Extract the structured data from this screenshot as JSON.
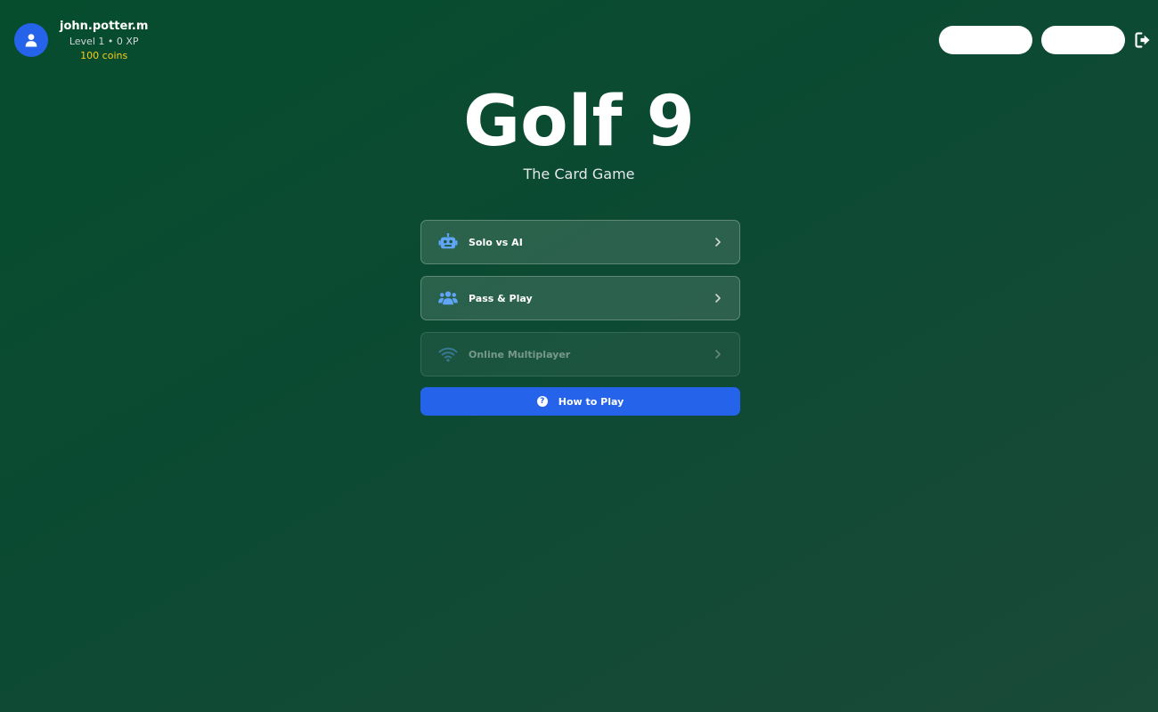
{
  "user": {
    "username": "john.potter.m",
    "level_text": "Level 1 • 0 XP",
    "coins_text": "100 coins",
    "avatar_icon": "user-icon"
  },
  "header": {
    "logout_icon": "logout-icon"
  },
  "hero": {
    "title": "Golf 9",
    "subtitle": "The Card Game"
  },
  "menu": {
    "items": [
      {
        "label": "Solo vs AI",
        "icon": "robot-icon",
        "enabled": true
      },
      {
        "label": "Pass & Play",
        "icon": "users-icon",
        "enabled": true
      },
      {
        "label": "Online Multiplayer",
        "icon": "wifi-icon",
        "enabled": false
      }
    ],
    "how_to_play": {
      "label": "How to Play",
      "icon": "question-icon",
      "icon_glyph": "?"
    }
  },
  "colors": {
    "accent": "#2563eb",
    "coins": "#facc15",
    "icon_blue": "#60a5fa"
  }
}
